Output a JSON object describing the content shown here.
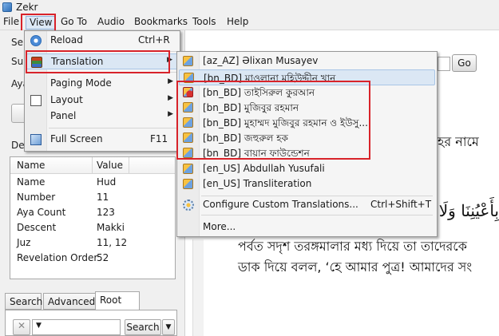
{
  "window": {
    "title": "Zekr"
  },
  "menubar": [
    "File",
    "View",
    "Go To",
    "Audio",
    "Bookmarks",
    "Tools",
    "Help"
  ],
  "left_panel": {
    "truncated_labels": [
      "Sel",
      "Sur",
      "Aya",
      "Det"
    ],
    "details_table": {
      "headers": [
        "Name",
        "Value"
      ],
      "rows": [
        [
          "Name",
          "Hud"
        ],
        [
          "Number",
          "11"
        ],
        [
          "Aya Count",
          "123"
        ],
        [
          "Descent",
          "Makki"
        ],
        [
          "Juz",
          "11, 12"
        ],
        [
          "Revelation Order",
          "52"
        ]
      ]
    },
    "tabs": [
      "Search",
      "Advanced",
      "Root"
    ],
    "search_button": "Search"
  },
  "right_area": {
    "go_button": "Go",
    "bengali_fragment": "হর নামে",
    "arabic_fragment": "بِأَعْيُنِنَا وَلَا تُ",
    "bengali_line_1": "পর্বত সদৃশ তরঙ্গমালার মধ্য দিয়ে তা তাদেরকে",
    "bengali_line_2": "ডাক দিয়ে বলল, ‘হে আমার পুত্র! আমাদের সং"
  },
  "view_menu": {
    "items": [
      {
        "label": "Reload",
        "shortcut": "Ctrl+R",
        "icon": "reload-icon"
      },
      {
        "label": "Translation",
        "icon": "books-icon",
        "submenu": true
      },
      {
        "label": "Paging Mode",
        "submenu": true
      },
      {
        "label": "Layout",
        "icon": "layout-icon",
        "submenu": true
      },
      {
        "label": "Panel",
        "submenu": true
      },
      {
        "label": "Full Screen",
        "shortcut": "F11",
        "icon": "fullscreen-icon"
      }
    ]
  },
  "translation_menu": {
    "items": [
      "[az_AZ] Əlixan Musayev",
      "[bn_BD] মাওলানা মহিউদ্দীন খান",
      "[bn_BD] তাইসিরুল কুরআন",
      "[bn_BD] মুজিবুর রহমান",
      "[bn_BD] মুহাম্মদ মুজিবুর রহমান ও ইউসু...",
      "[bn_BD] জহুরুল হক",
      "[bn_BD] বায়ান ফাউন্ডেশন",
      "[en_US] Abdullah Yusufali",
      "[en_US] Transliteration"
    ],
    "configure": {
      "label": "Configure Custom Translations...",
      "shortcut": "Ctrl+Shift+T"
    },
    "more": "More..."
  },
  "colors": {
    "highlight_red": "#d8232a",
    "menu_hover": "#dbe7f4"
  }
}
